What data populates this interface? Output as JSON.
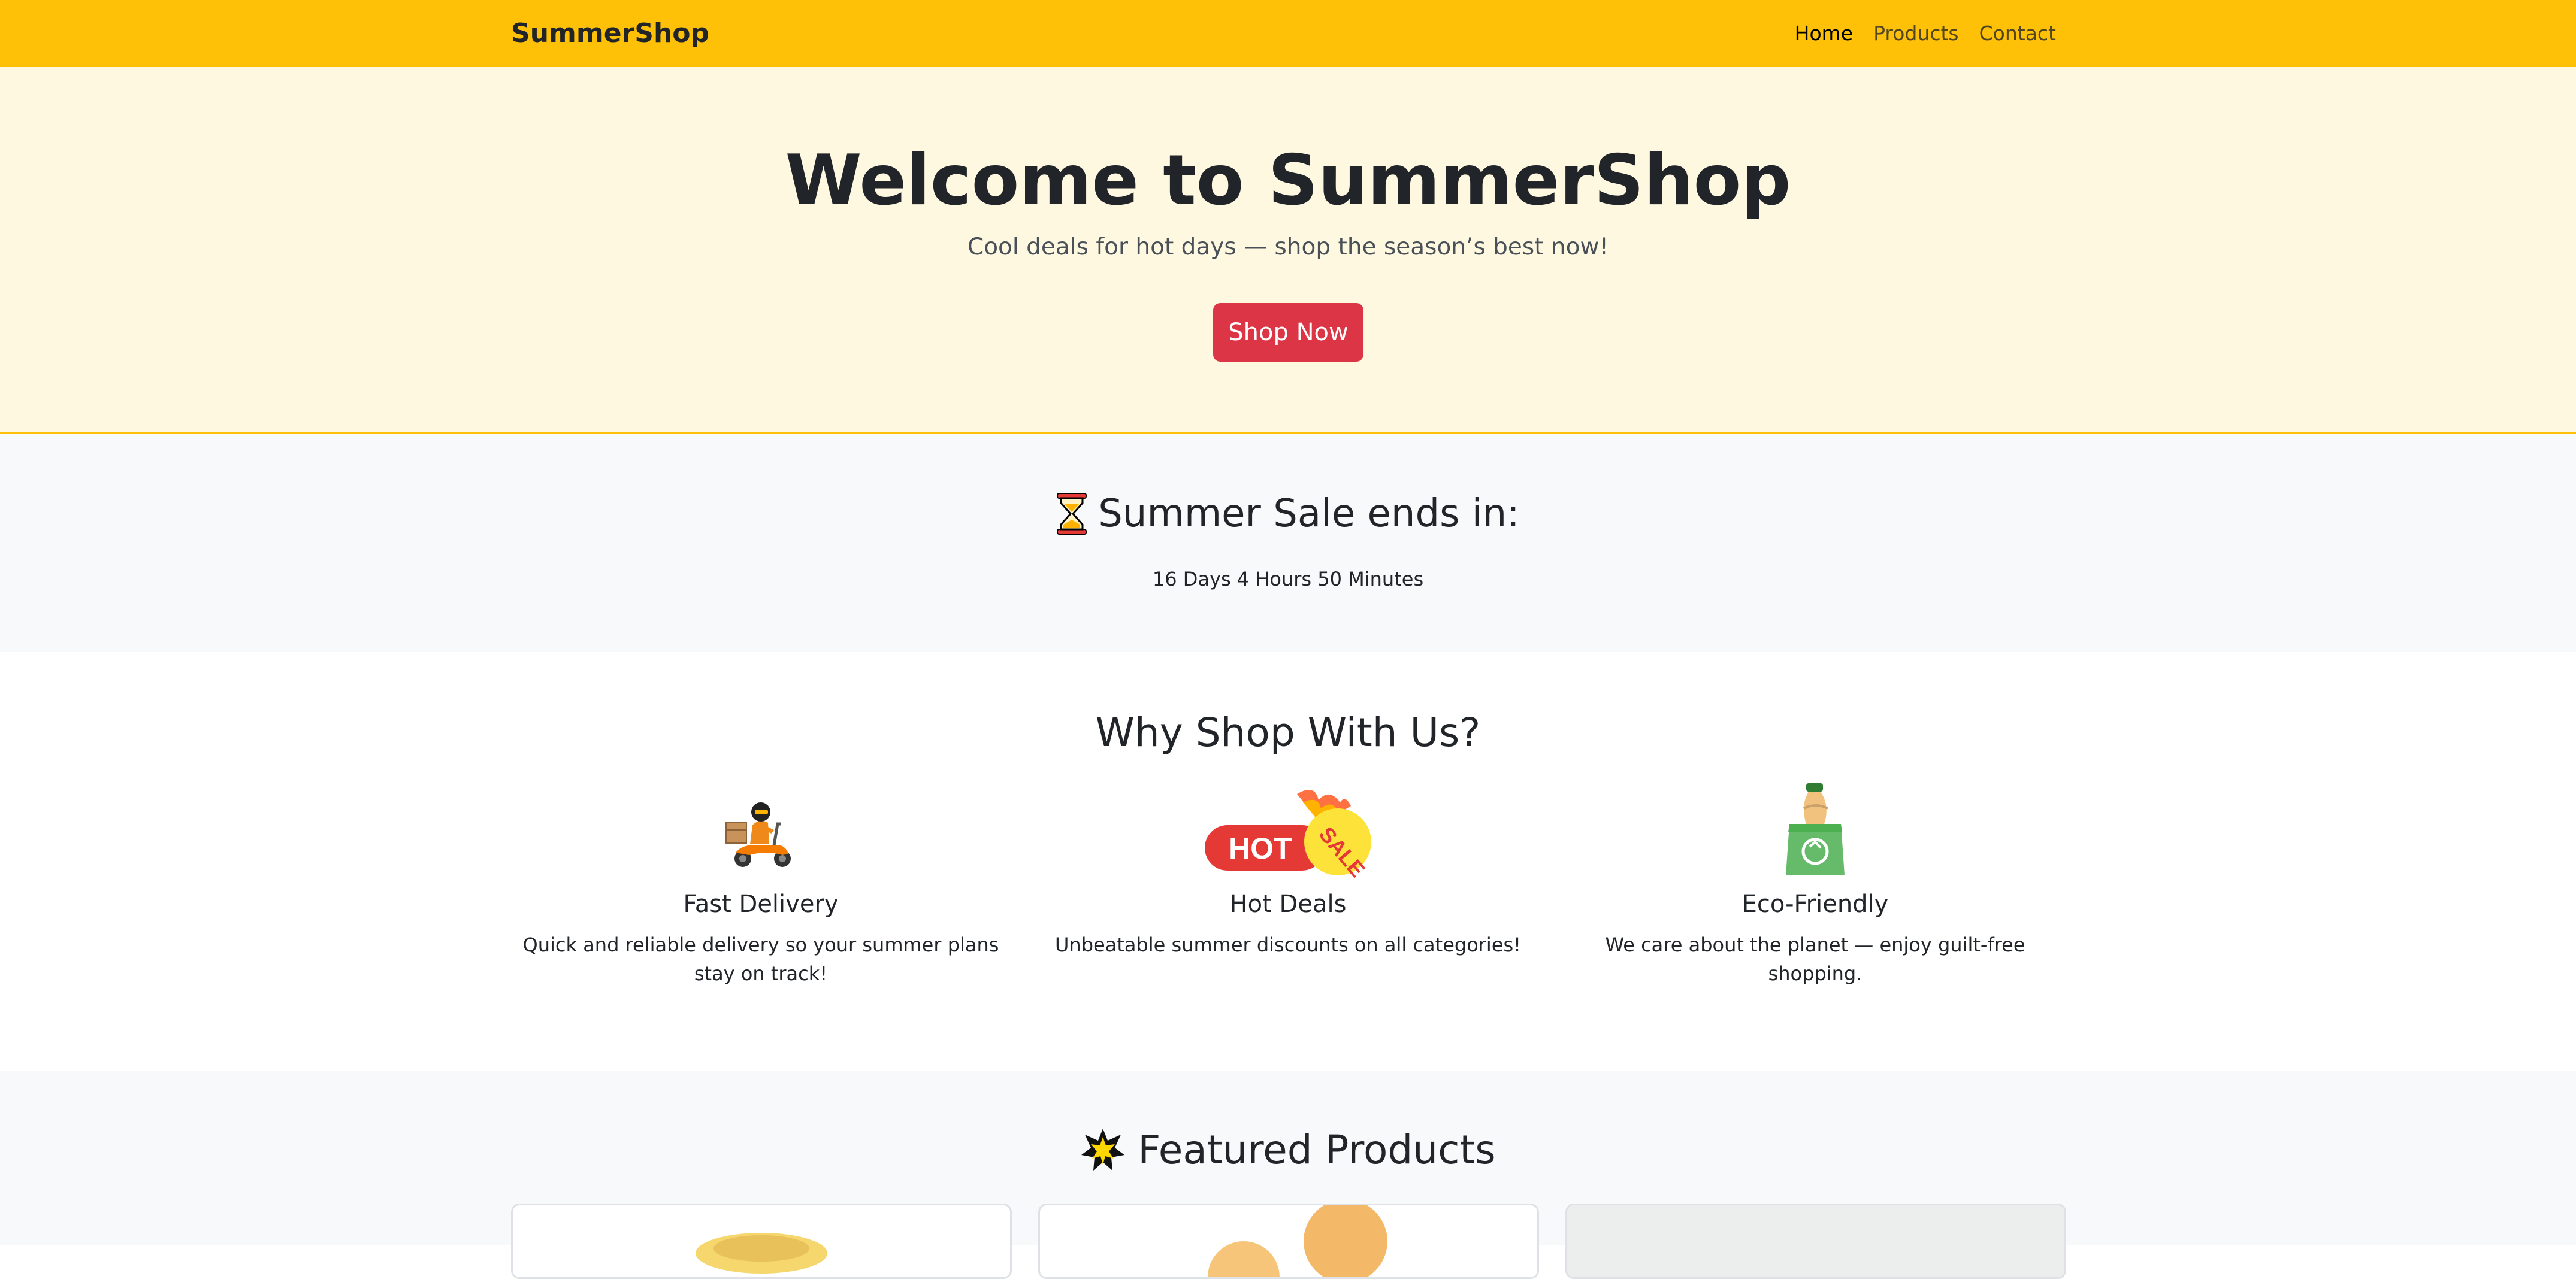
{
  "brand": "SummerShop",
  "nav": {
    "home": "Home",
    "products": "Products",
    "contact": "Contact"
  },
  "hero": {
    "title": "Welcome to SummerShop",
    "subtitle": "Cool deals for hot days — shop the season’s best now!",
    "cta": "Shop Now"
  },
  "sale": {
    "title": "Summer Sale ends in:",
    "countdown": "16 Days 4 Hours 50 Minutes"
  },
  "why": {
    "title": "Why Shop With Us?",
    "features": [
      {
        "title": "Fast Delivery",
        "text": "Quick and reliable delivery so your summer plans stay on track!",
        "icon": "delivery-scooter-icon"
      },
      {
        "title": "Hot Deals",
        "text": "Unbeatable summer discounts on all categories!",
        "icon": "hot-sale-icon",
        "badge_left": "HOT",
        "badge_right": "SALE"
      },
      {
        "title": "Eco-Friendly",
        "text": "We care about the planet — enjoy guilt-free shopping.",
        "icon": "eco-bag-icon"
      }
    ]
  },
  "featured": {
    "title": "Featured Products"
  },
  "colors": {
    "navbar": "#ffc107",
    "hero_bg": "#fff8e1",
    "button": "#dc3545",
    "section_alt": "#f8f9fa"
  }
}
